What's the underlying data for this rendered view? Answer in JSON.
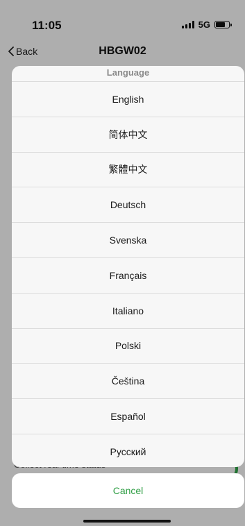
{
  "status_bar": {
    "time": "11:05",
    "network": "5G"
  },
  "nav": {
    "back_label": "Back",
    "title": "HBGW02"
  },
  "background": {
    "partial_text": "Collect real-time status"
  },
  "sheet": {
    "title": "Language",
    "options": [
      {
        "label": "English"
      },
      {
        "label": "简体中文"
      },
      {
        "label": "繁體中文"
      },
      {
        "label": "Deutsch"
      },
      {
        "label": "Svenska"
      },
      {
        "label": "Français"
      },
      {
        "label": "Italiano"
      },
      {
        "label": "Polski"
      },
      {
        "label": "Čeština"
      },
      {
        "label": "Español"
      },
      {
        "label": "Русский"
      }
    ],
    "cancel_label": "Cancel"
  },
  "colors": {
    "accent": "#2f9e44",
    "sheet_bg": "#f7f7f7",
    "divider": "#dcdcdc"
  },
  "icons": [
    "signal-icon",
    "battery-icon",
    "chevron-left-icon"
  ]
}
